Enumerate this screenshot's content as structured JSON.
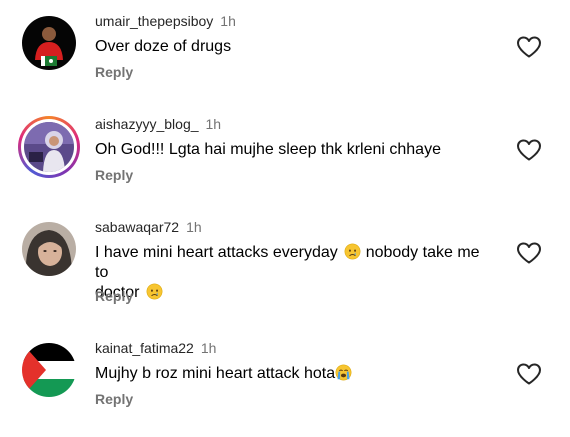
{
  "comments": [
    {
      "username": "umair_thepepsiboy",
      "time": "1h",
      "text": "Over doze of drugs",
      "reply": "Reply",
      "avatar_icon": "person-with-flag-avatar"
    },
    {
      "username": "aishazyyy_blog_",
      "time": "1h",
      "text": "Oh God!!! Lgta hai mujhe sleep thk krleni chhaye",
      "reply": "Reply",
      "avatar_icon": "woman-hijab-avatar-story-ring"
    },
    {
      "username": "sabawaqar72",
      "time": "1h",
      "text_part1": "I have mini heart attacks everyday",
      "text_part2": "nobody take me to",
      "text_line2": "doctor",
      "reply": "Reply",
      "avatar_icon": "woman-hijab-photo-avatar"
    },
    {
      "username": "kainat_fatima22",
      "time": "1h",
      "text": "Mujhy b roz mini heart attack hota",
      "reply": "Reply",
      "avatar_icon": "palestine-flag-avatar"
    }
  ],
  "icons": {
    "like": "heart-outline-icon",
    "sad": "crying-face-emoji",
    "loud_cry": "loudly-crying-face-emoji"
  },
  "colors": {
    "username": "#262626",
    "muted": "#737373",
    "text": "#000000"
  }
}
